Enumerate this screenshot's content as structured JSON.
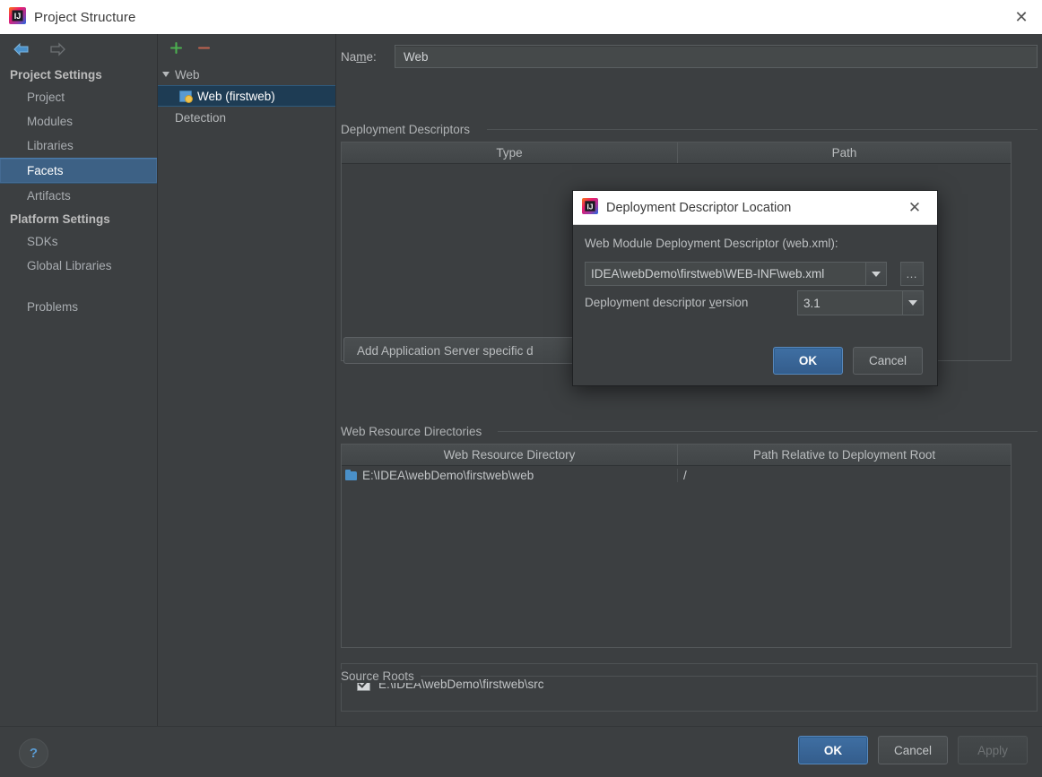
{
  "window": {
    "title": "Project Structure",
    "icon": "intellij-idea-icon",
    "close_label": "✕"
  },
  "nav_toolbar": {
    "back_icon": "back-arrow-icon",
    "forward_icon": "forward-arrow-icon"
  },
  "sidebar": {
    "groups": [
      {
        "label": "Project Settings",
        "items": [
          {
            "label": "Project",
            "selected": false
          },
          {
            "label": "Modules",
            "selected": false
          },
          {
            "label": "Libraries",
            "selected": false
          },
          {
            "label": "Facets",
            "selected": true
          },
          {
            "label": "Artifacts",
            "selected": false
          }
        ]
      },
      {
        "label": "Platform Settings",
        "items": [
          {
            "label": "SDKs",
            "selected": false
          },
          {
            "label": "Global Libraries",
            "selected": false
          }
        ]
      }
    ],
    "extra_item": {
      "label": "Problems",
      "selected": false
    }
  },
  "tree": {
    "toolbar": {
      "add_icon": "plus-icon",
      "remove_icon": "minus-icon"
    },
    "nodes": [
      {
        "label": "Web",
        "type": "group",
        "expanded": true,
        "selected": false
      },
      {
        "label": "Web (firstweb)",
        "type": "facet",
        "selected": true
      },
      {
        "label": "Detection",
        "type": "group",
        "selected": false
      }
    ]
  },
  "facet": {
    "name_label": "Name:",
    "name_label_mnemonic": "m",
    "name_value": "Web",
    "deployment_descriptors": {
      "section_title": "Deployment Descriptors",
      "columns": [
        "Type",
        "Path"
      ],
      "rows": [],
      "tools": [
        "plus-icon",
        "minus-icon",
        "pencil-icon"
      ]
    },
    "add_app_server_button": "Add Application Server specific descriptor",
    "add_app_server_button_visible": "Add Application Server specific d",
    "web_resource_directories": {
      "section_title": "Web Resource Directories",
      "columns": [
        "Web Resource Directory",
        "Path Relative to Deployment Root"
      ],
      "rows": [
        {
          "directory": "E:\\IDEA\\webDemo\\firstweb\\web",
          "relative_path": "/",
          "icon": "folder-icon"
        }
      ],
      "tools": [
        "plus-icon",
        "minus-icon",
        "pencil-icon",
        "help-icon"
      ]
    },
    "source_roots": {
      "section_title": "Source Roots",
      "rows": [
        {
          "path": "E:\\IDEA\\webDemo\\firstweb\\src",
          "checked": true
        }
      ]
    }
  },
  "dialog": {
    "title": "Deployment Descriptor Location",
    "icon": "intellij-idea-icon",
    "close_label": "✕",
    "descriptor_label": "Web Module Deployment Descriptor (web.xml):",
    "descriptor_value": "IDEA\\webDemo\\firstweb\\WEB-INF\\web.xml",
    "browse_label": "…",
    "version_label": "Deployment descriptor version",
    "version_label_mnemonic": "v",
    "version_value": "3.1",
    "ok_label": "OK",
    "cancel_label": "Cancel"
  },
  "footer": {
    "help_label": "?",
    "ok_label": "OK",
    "cancel_label": "Cancel",
    "apply_label": "Apply",
    "apply_enabled": false
  },
  "colors": {
    "background": "#3c3f41",
    "selection_blue": "#3d6185",
    "tree_selection": "#1e3c54",
    "accent_blue": "#5a9ad1",
    "primary_button": "#3f6fa3",
    "plus_green": "#4caf50",
    "minus_red": "#c0634f",
    "titlebar": "#ffffff"
  }
}
